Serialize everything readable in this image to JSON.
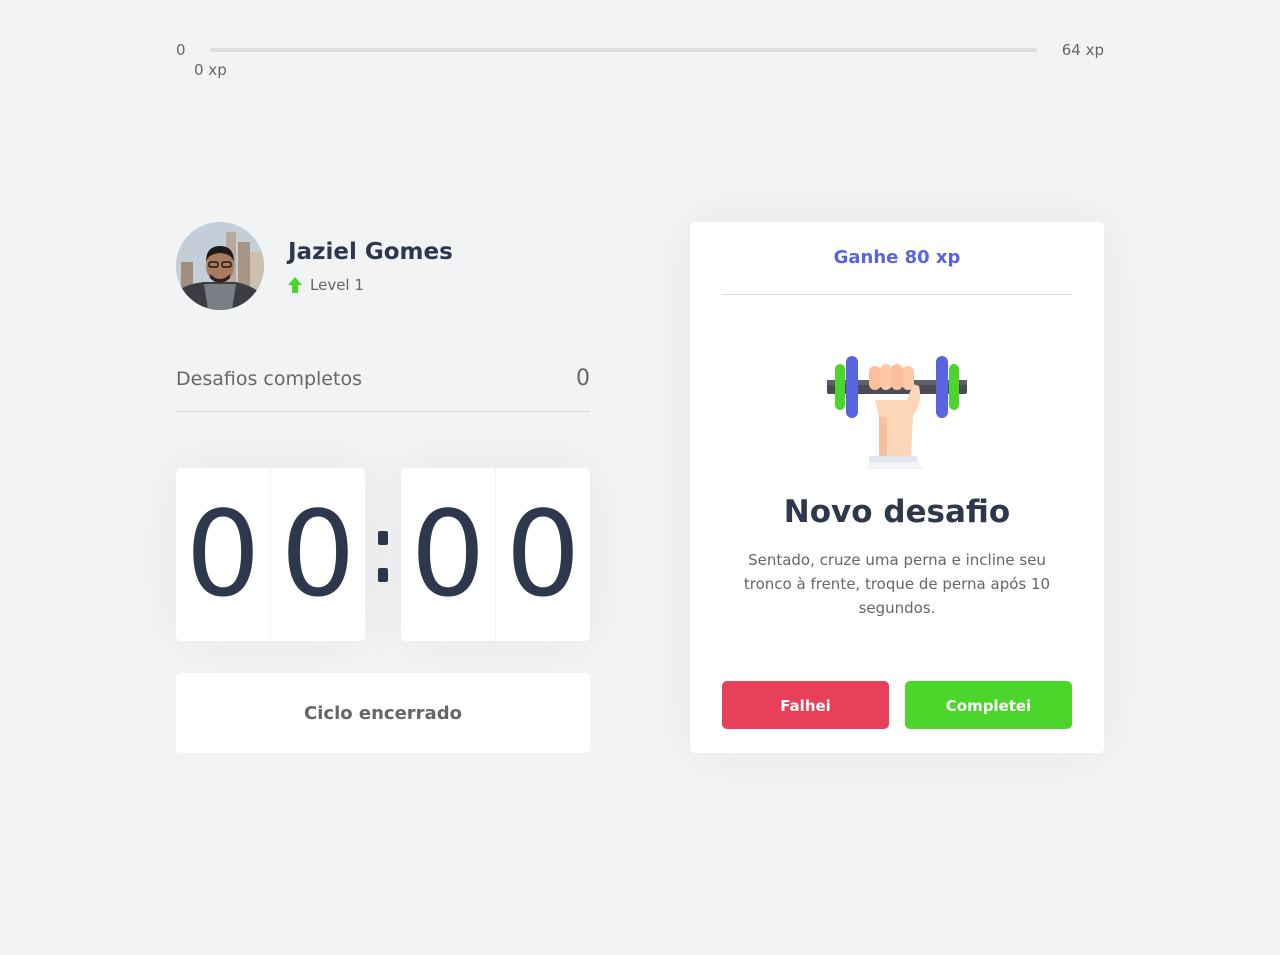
{
  "xp_bar": {
    "min_label": "0",
    "max_label": "64 xp",
    "current_label": "0 xp",
    "progress_fraction": 0
  },
  "profile": {
    "name": "Jaziel Gomes",
    "level_label": "Level 1",
    "level_icon": "level-up-arrow-icon",
    "avatar": "user-photo"
  },
  "completed_challenges": {
    "label": "Desafios completos",
    "count": "0"
  },
  "countdown": {
    "minute_left": "0",
    "minute_right": "0",
    "second_left": "0",
    "second_right": "0",
    "separator": ":"
  },
  "cycle_button": {
    "label": "Ciclo encerrado"
  },
  "challenge": {
    "reward_label": "Ganhe 80 xp",
    "icon": "dumbbell-icon",
    "title": "Novo desafio",
    "description": "Sentado, cruze uma perna e incline seu tronco à frente, troque de perna após 10 segundos.",
    "fail_label": "Falhei",
    "success_label": "Completei"
  },
  "colors": {
    "background": "#f2f3f5",
    "text": "#666666",
    "title": "#2e384d",
    "blue": "#5965e0",
    "red": "#e83f5b",
    "green": "#4cd62b"
  }
}
